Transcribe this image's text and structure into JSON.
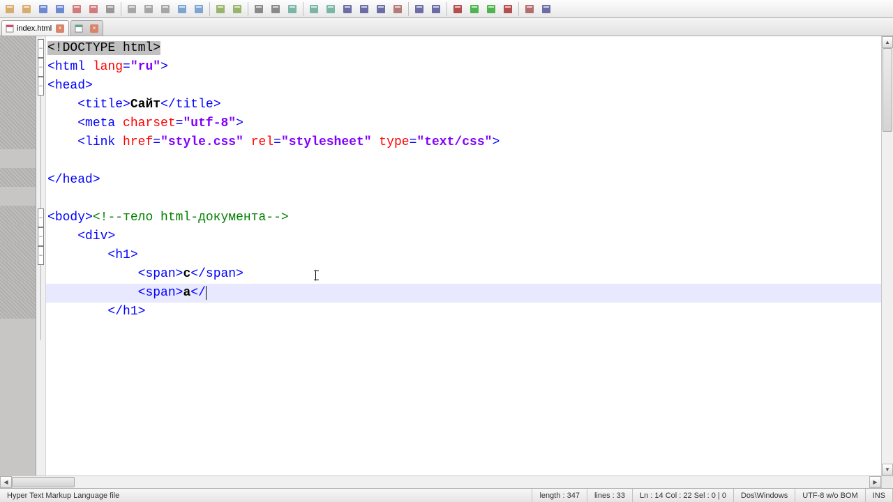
{
  "toolbar_icons": [
    "new",
    "open",
    "save",
    "save-all",
    "close",
    "close-all",
    "print",
    "cut",
    "copy",
    "paste",
    "undo",
    "redo",
    "find",
    "replace",
    "zoom-in",
    "zoom-out",
    "sync",
    "word-wrap",
    "show-all",
    "indent-guide",
    "fold-all",
    "unfold-all",
    "hidden-chars",
    "doc-map",
    "func-list",
    "record-macro",
    "play-macro",
    "run-macro",
    "stop-macro",
    "spell-check",
    "doc-switcher"
  ],
  "tabs": [
    {
      "name": "index.html",
      "active": true
    },
    {
      "name": "",
      "active": false
    }
  ],
  "code_lines": [
    {
      "n": 1,
      "indent": 0,
      "segs": [
        {
          "c": "sel-doctype",
          "t": "<!"
        },
        {
          "c": "sel-doctype",
          "t": "DOCTYPE html"
        },
        {
          "c": "sel-doctype",
          "t": ">"
        }
      ],
      "fold": "minus"
    },
    {
      "n": 2,
      "indent": 0,
      "segs": [
        {
          "c": "t-pun",
          "t": "<"
        },
        {
          "c": "t-tag",
          "t": "html "
        },
        {
          "c": "t-attr",
          "t": "lang"
        },
        {
          "c": "t-tag",
          "t": "="
        },
        {
          "c": "t-str",
          "t": "\"ru\""
        },
        {
          "c": "t-pun",
          "t": ">"
        }
      ],
      "fold": "minus"
    },
    {
      "n": 3,
      "indent": 0,
      "segs": [
        {
          "c": "t-pun",
          "t": "<"
        },
        {
          "c": "t-tag",
          "t": "head"
        },
        {
          "c": "t-pun",
          "t": ">"
        }
      ],
      "fold": "minus"
    },
    {
      "n": 4,
      "indent": 1,
      "segs": [
        {
          "c": "t-pun",
          "t": "<"
        },
        {
          "c": "t-tag",
          "t": "title"
        },
        {
          "c": "t-pun",
          "t": ">"
        },
        {
          "c": "t-text",
          "t": "Сайт"
        },
        {
          "c": "t-pun",
          "t": "</"
        },
        {
          "c": "t-tag",
          "t": "title"
        },
        {
          "c": "t-pun",
          "t": ">"
        }
      ],
      "fold": "line"
    },
    {
      "n": 5,
      "indent": 1,
      "segs": [
        {
          "c": "t-pun",
          "t": "<"
        },
        {
          "c": "t-tag",
          "t": "meta "
        },
        {
          "c": "t-attr",
          "t": "charset"
        },
        {
          "c": "t-tag",
          "t": "="
        },
        {
          "c": "t-str",
          "t": "\"utf-8\""
        },
        {
          "c": "t-pun",
          "t": ">"
        }
      ],
      "fold": "line"
    },
    {
      "n": 6,
      "indent": 1,
      "segs": [
        {
          "c": "t-pun",
          "t": "<"
        },
        {
          "c": "t-tag",
          "t": "link "
        },
        {
          "c": "t-attr",
          "t": "href"
        },
        {
          "c": "t-tag",
          "t": "="
        },
        {
          "c": "t-str",
          "t": "\"style.css\""
        },
        {
          "c": "t-tag",
          "t": " "
        },
        {
          "c": "t-attr",
          "t": "rel"
        },
        {
          "c": "t-tag",
          "t": "="
        },
        {
          "c": "t-str",
          "t": "\"stylesheet\""
        },
        {
          "c": "t-tag",
          "t": " "
        },
        {
          "c": "t-attr",
          "t": "type"
        },
        {
          "c": "t-tag",
          "t": "="
        },
        {
          "c": "t-str",
          "t": "\"text/css\""
        },
        {
          "c": "t-pun",
          "t": ">"
        }
      ],
      "fold": "line"
    },
    {
      "n": 7,
      "indent": 0,
      "segs": [],
      "fold": "line"
    },
    {
      "n": 8,
      "indent": 0,
      "segs": [
        {
          "c": "t-pun",
          "t": "</"
        },
        {
          "c": "t-tag",
          "t": "head"
        },
        {
          "c": "t-pun",
          "t": ">"
        }
      ],
      "fold": "line"
    },
    {
      "n": 9,
      "indent": 0,
      "segs": [],
      "fold": "line"
    },
    {
      "n": 10,
      "indent": 0,
      "segs": [
        {
          "c": "t-pun",
          "t": "<"
        },
        {
          "c": "t-tag",
          "t": "body"
        },
        {
          "c": "t-pun",
          "t": ">"
        },
        {
          "c": "t-cmt",
          "t": "<!--тело html-документа-->"
        }
      ],
      "fold": "minus"
    },
    {
      "n": 11,
      "indent": 1,
      "segs": [
        {
          "c": "t-pun",
          "t": "<"
        },
        {
          "c": "t-tag",
          "t": "div"
        },
        {
          "c": "t-pun",
          "t": ">"
        }
      ],
      "fold": "minus"
    },
    {
      "n": 12,
      "indent": 2,
      "segs": [
        {
          "c": "t-pun",
          "t": "<"
        },
        {
          "c": "t-tag",
          "t": "h1"
        },
        {
          "c": "t-pun",
          "t": ">"
        }
      ],
      "fold": "minus"
    },
    {
      "n": 13,
      "indent": 3,
      "segs": [
        {
          "c": "t-pun",
          "t": "<"
        },
        {
          "c": "t-tag",
          "t": "span"
        },
        {
          "c": "t-pun",
          "t": ">"
        },
        {
          "c": "t-text",
          "t": "с"
        },
        {
          "c": "t-pun",
          "t": "</"
        },
        {
          "c": "t-tag",
          "t": "span"
        },
        {
          "c": "t-pun",
          "t": ">"
        }
      ],
      "fold": "line"
    },
    {
      "n": 14,
      "indent": 3,
      "segs": [
        {
          "c": "t-pun",
          "t": "<"
        },
        {
          "c": "t-tag",
          "t": "span"
        },
        {
          "c": "t-pun",
          "t": ">"
        },
        {
          "c": "t-text",
          "t": "а"
        },
        {
          "c": "t-tag",
          "t": "</"
        }
      ],
      "fold": "line",
      "hl": true
    },
    {
      "n": 15,
      "indent": 2,
      "segs": [
        {
          "c": "t-pun",
          "t": "</"
        },
        {
          "c": "t-tag",
          "t": "h1"
        },
        {
          "c": "t-pun",
          "t": ">"
        }
      ],
      "fold": "line"
    },
    {
      "n": 16,
      "indent": 0,
      "segs": [],
      "fold": "line"
    }
  ],
  "cursor": {
    "row_index": 13,
    "after_text": true
  },
  "status": {
    "filetype": "Hyper Text Markup Language file",
    "length": "length : 347",
    "lines": "lines : 33",
    "pos": "Ln : 14   Col : 22   Sel : 0 | 0",
    "eol": "Dos\\Windows",
    "enc": "UTF-8 w/o BOM",
    "mode": "INS"
  }
}
